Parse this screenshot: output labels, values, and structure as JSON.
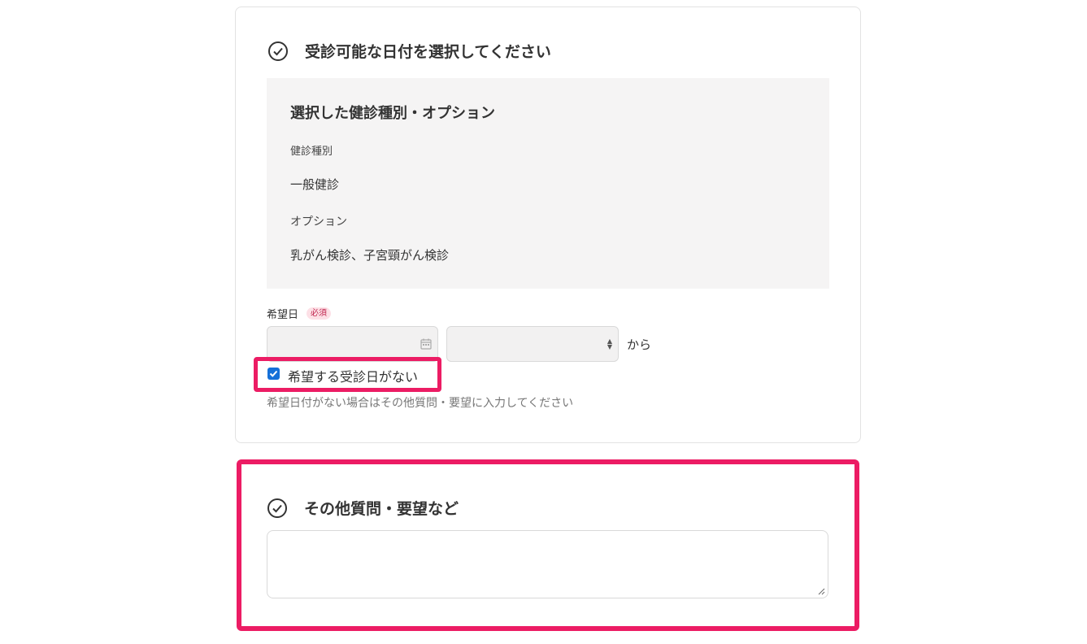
{
  "date_section": {
    "title": "受診可能な日付を選択してください",
    "summary": {
      "heading": "選択した健診種別・オプション",
      "type_label": "健診種別",
      "type_value": "一般健診",
      "option_label": "オプション",
      "option_value": "乳がん検診、子宮頸がん検診"
    },
    "desired_date_label": "希望日",
    "required_badge": "必須",
    "date_value": "",
    "time_value": "",
    "kara": "から",
    "no_date_checkbox_label": "希望する受診日がない",
    "no_date_checked": true,
    "helper_text": "希望日付がない場合はその他質問・要望に入力してください"
  },
  "other_section": {
    "title": "その他質問・要望など",
    "textarea_value": ""
  },
  "colors": {
    "highlight": "#ec1c64",
    "checkbox": "#1570d8",
    "badge_text": "#c0244e",
    "badge_bg": "#fde0e6"
  },
  "icons": [
    "check-circle-icon",
    "calendar-icon",
    "select-arrows-icon",
    "checkmark-icon",
    "resize-grip-icon"
  ]
}
